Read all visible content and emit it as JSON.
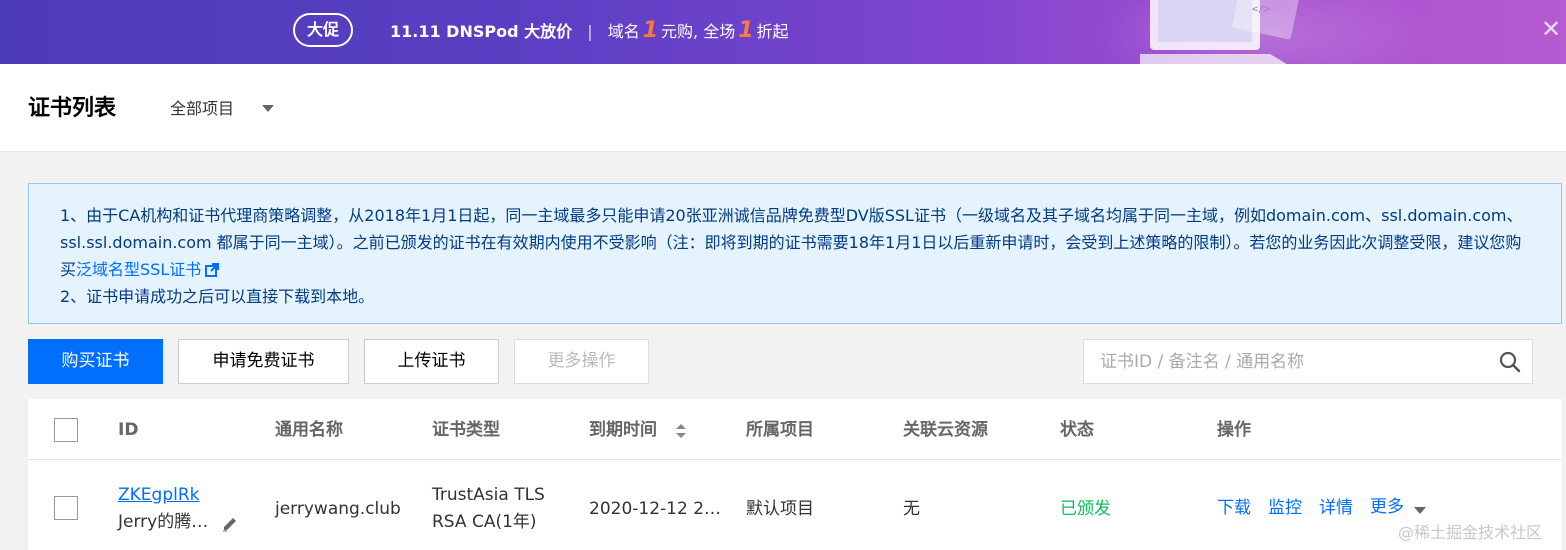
{
  "banner": {
    "badge": "大促",
    "promo_prefix": "11.11 DNSPod 大放价",
    "sep": "|",
    "promo_text1": "域名",
    "highlight1": "1",
    "promo_text2": "元购, 全场",
    "highlight2": "1",
    "promo_text3": "折起",
    "close_glyph": "✕"
  },
  "header": {
    "title": "证书列表",
    "project_selector": "全部项目"
  },
  "notice": {
    "line1": "1、由于CA机构和证书代理商策略调整，从2018年1月1日起，同一主域最多只能申请20张亚洲诚信品牌免费型DV版SSL证书（一级域名及其子域名均属于同一主域，例如domain.com、ssl.domain.com、ssl.ssl.domain.com 都属于同一主域）。之前已颁发的证书在有效期内使用不受影响（注：即将到期的证书需要18年1月1日以后重新申请时，会受到上述策略的限制）。若您的业务因此次调整受限，建议您购买",
    "line1_link": "泛域名型SSL证书",
    "line2": "2、证书申请成功之后可以直接下载到本地。"
  },
  "toolbar": {
    "buy": "购买证书",
    "apply_free": "申请免费证书",
    "upload": "上传证书",
    "more_actions": "更多操作",
    "search_placeholder": "证书ID / 备注名 / 通用名称"
  },
  "table": {
    "columns": [
      "ID",
      "通用名称",
      "证书类型",
      "到期时间",
      "所属项目",
      "关联云资源",
      "状态",
      "操作"
    ],
    "rows": [
      {
        "id": "ZKEgplRk",
        "remark": "Jerry的腾…",
        "common_name": "jerrywang.club",
        "type_line1": "TrustAsia TLS",
        "type_line2": "RSA CA(1年)",
        "expire": "2020-12-12 2…",
        "project": "默认项目",
        "resources": "无",
        "status": "已颁发",
        "ops": [
          "下载",
          "监控",
          "详情",
          "更多"
        ]
      }
    ]
  },
  "watermark": "@稀土掘金技术社区",
  "colors": {
    "primary": "#006eff",
    "status_ok": "#0abf5b",
    "notice_bg": "#e5f3ff",
    "promo_highlight": "#ff7a3d"
  }
}
